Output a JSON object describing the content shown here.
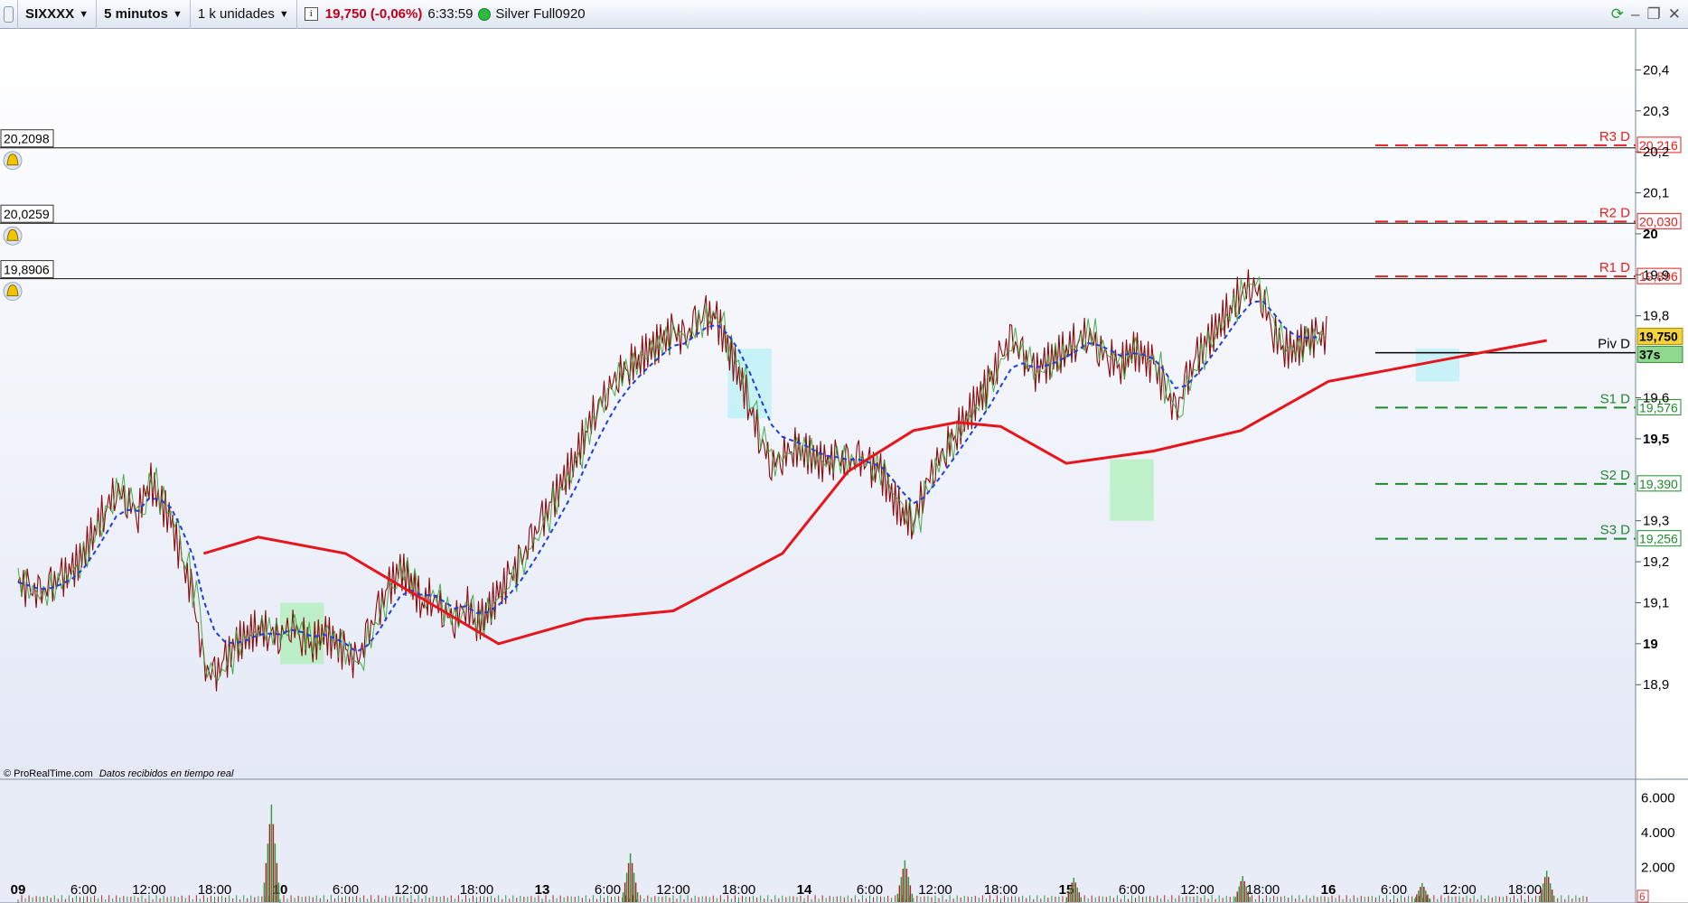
{
  "toolbar": {
    "grip_icon": "grip-icon",
    "symbol": "SIXXXX",
    "timeframe": "5 minutos",
    "units": "1 k unidades",
    "info_icon": "info-icon",
    "quote": "19,750 (-0,06%)",
    "time": "6:33:59",
    "status_label": "Silver Full0920",
    "quote_color": "#c0001a"
  },
  "window_controls": {
    "sync": "sync-icon",
    "minimize": "minimize-icon",
    "restore": "restore-icon",
    "close": "close-icon"
  },
  "alerts": [
    {
      "value": "20,2098",
      "icon": "bell-icon"
    },
    {
      "value": "20,0259",
      "icon": "bell-icon"
    },
    {
      "value": "19,8906",
      "icon": "bell-icon"
    }
  ],
  "credit": "© ProRealTime.com",
  "credit_note": "Datos recibidos en tiempo real",
  "colors": {
    "price_line": "#8b0a0a",
    "close_line": "#3aa53a",
    "moving_average": "#e8141b",
    "signal_line": "#1d3fd8",
    "cloud_bull": "#a8f0f7",
    "cloud_bear": "#9ff0a8",
    "resistance": "#e2201e",
    "support": "#1e8a2e"
  },
  "chart_data": {
    "type": "line",
    "symbol": "SIXXXX",
    "ylim": [
      18.8,
      20.42
    ],
    "y_ticks": [
      "20,4",
      "20,3",
      "20,2",
      "20,1",
      "20",
      "19,9",
      "19,8",
      "19,6",
      "19,5",
      "19,3",
      "19,2",
      "19,1",
      "19",
      "18,9"
    ],
    "y_tick_values": [
      20.4,
      20.3,
      20.2,
      20.1,
      20.0,
      19.9,
      19.8,
      19.6,
      19.5,
      19.3,
      19.2,
      19.1,
      19.0,
      18.9
    ],
    "y_bold_ticks": [
      "20",
      "19,5",
      "19"
    ],
    "x_ticks": [
      "09",
      "6:00",
      "12:00",
      "18:00",
      "10",
      "6:00",
      "12:00",
      "18:00",
      "13",
      "6:00",
      "12:00",
      "18:00",
      "14",
      "6:00",
      "12:00",
      "18:00",
      "15",
      "6:00",
      "12:00",
      "18:00",
      "16",
      "6:00",
      "12:00",
      "18:00"
    ],
    "x_tick_index": [
      0,
      6,
      12,
      18,
      24,
      30,
      36,
      42,
      48,
      54,
      60,
      66,
      72,
      78,
      84,
      90,
      96,
      102,
      108,
      114,
      120,
      126,
      132,
      138
    ],
    "x_bold_ticks": [
      "09",
      "10",
      "13",
      "14",
      "15",
      "16"
    ],
    "x_max_index": 144,
    "series": [
      {
        "key": "price",
        "hourly_close": [
          19.15,
          19.13,
          19.12,
          19.14,
          19.16,
          19.18,
          19.22,
          19.28,
          19.33,
          19.38,
          19.35,
          19.32,
          19.4,
          19.35,
          19.3,
          19.2,
          19.12,
          18.94,
          18.92,
          18.96,
          19.0,
          19.02,
          19.04,
          19.03,
          19.02,
          19.05,
          19.02,
          19.0,
          19.03,
          19.0,
          18.98,
          18.95,
          19.02,
          19.08,
          19.14,
          19.18,
          19.15,
          19.1,
          19.12,
          19.08,
          19.06,
          19.1,
          19.05,
          19.08,
          19.12,
          19.16,
          19.2,
          19.25,
          19.3,
          19.35,
          19.4,
          19.45,
          19.52,
          19.58,
          19.62,
          19.66,
          19.68,
          19.7,
          19.72,
          19.74,
          19.76,
          19.74,
          19.78,
          19.8,
          19.79,
          19.72,
          19.66,
          19.58,
          19.5,
          19.44,
          19.46,
          19.48,
          19.47,
          19.45,
          19.44,
          19.45,
          19.44,
          19.45,
          19.43,
          19.42,
          19.36,
          19.32,
          19.3,
          19.38,
          19.44,
          19.48,
          19.52,
          19.56,
          19.6,
          19.64,
          19.7,
          19.74,
          19.7,
          19.66,
          19.68,
          19.7,
          19.72,
          19.74,
          19.76,
          19.72,
          19.7,
          19.68,
          19.72,
          19.7,
          19.68,
          19.62,
          19.56,
          19.64,
          19.7,
          19.74,
          19.78,
          19.82,
          19.86,
          19.88,
          19.84,
          19.76,
          19.72,
          19.72,
          19.74,
          19.75
        ]
      },
      {
        "key": "moving_average",
        "points": [
          [
            19,
            19.26
          ],
          [
            32,
            19.19
          ],
          [
            44,
            19.04
          ],
          [
            52,
            19.06
          ],
          [
            62,
            19.1
          ],
          [
            70,
            19.23
          ],
          [
            78,
            19.41
          ],
          [
            86,
            19.53
          ],
          [
            94,
            19.56
          ],
          [
            102,
            19.53
          ],
          [
            108,
            19.44
          ],
          [
            116,
            19.46
          ],
          [
            122,
            19.48
          ],
          [
            136,
            19.63
          ],
          [
            145,
            19.7
          ],
          [
            156,
            19.72
          ],
          [
            168,
            19.74
          ],
          [
            185,
            19.76
          ],
          [
            200,
            19.77
          ],
          [
            208,
            19.75
          ]
        ],
        "x_unit": "bar-offset"
      }
    ],
    "pivot_levels": [
      {
        "name": "R3 D",
        "value": "20,216"
      },
      {
        "name": "R2 D",
        "value": "20,030"
      },
      {
        "name": "R1 D",
        "value": "19,896"
      },
      {
        "name": "Piv D",
        "value": "19,710"
      },
      {
        "name": "S1 D",
        "value": "19,576"
      },
      {
        "name": "S2 D",
        "value": "19,390"
      },
      {
        "name": "S3 D",
        "value": "19,256"
      }
    ],
    "pivot_values": [
      20.216,
      20.03,
      19.896,
      19.71,
      19.576,
      19.39,
      19.256
    ],
    "current_price": "19,750",
    "current_price_value": 19.75,
    "countdown": "37s",
    "volume": {
      "ylim": [
        0,
        7000
      ],
      "ticks": [
        "6.000",
        "4.000",
        "2.000"
      ],
      "tick_values": [
        6000,
        4000,
        2000
      ],
      "current": "6",
      "peaks": [
        [
          24,
          5600
        ],
        [
          58,
          2800
        ],
        [
          84,
          2400
        ],
        [
          100,
          1400
        ],
        [
          116,
          1500
        ],
        [
          133,
          1100
        ],
        [
          150,
          1800
        ]
      ]
    }
  }
}
